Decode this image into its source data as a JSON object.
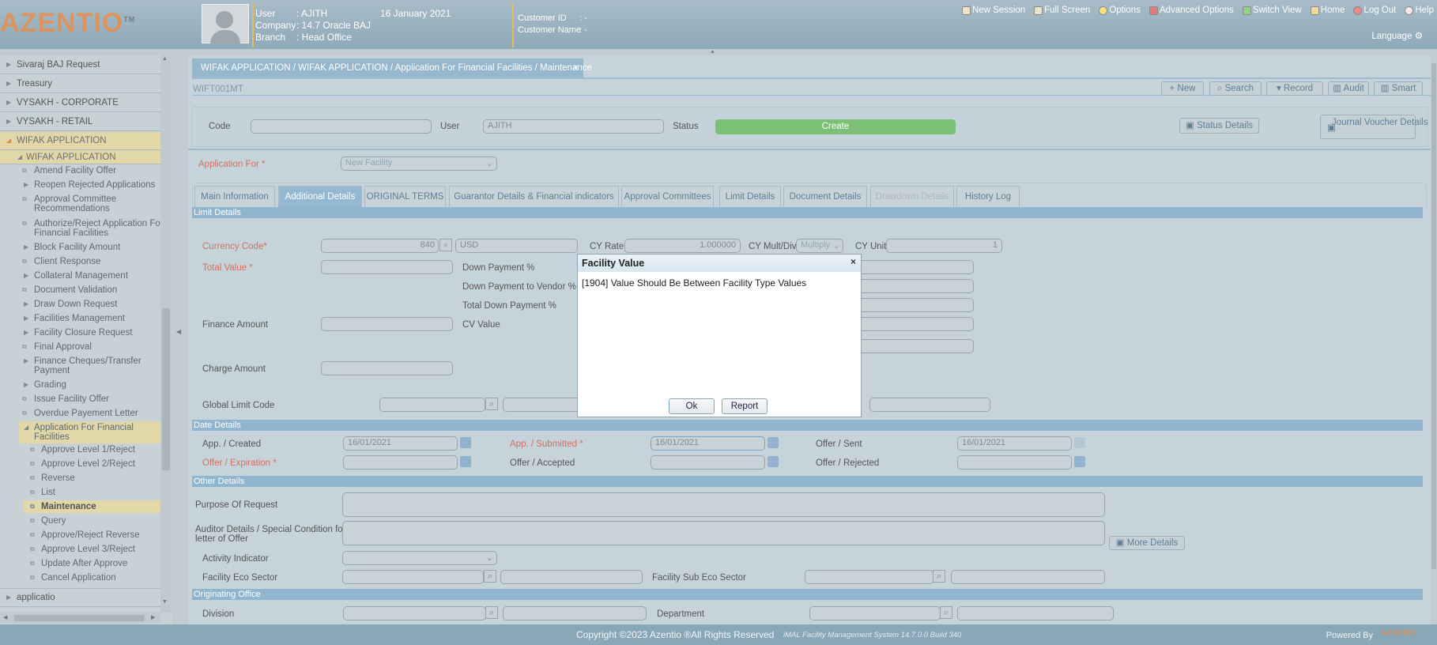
{
  "header": {
    "logo": "AZENTIO",
    "logo_tm": "TM",
    "user_label": "User",
    "user_value": ": AJITH",
    "company_label": "Company",
    "company_value": ": 14.7 Oracle BAJ",
    "branch_label": "Branch",
    "branch_value": ": Head Office",
    "date": "16 January 2021",
    "customer_id_label": "Customer ID",
    "customer_id_value": ":   -",
    "customer_name_label": "Customer Name",
    "customer_name_value": ": -",
    "links": [
      "New Session",
      "Full Screen",
      "Options",
      "Advanced Options",
      "Switch View",
      "Home",
      "Log Out",
      "Help"
    ],
    "language": "Language"
  },
  "sidebar": {
    "top_items": [
      "Sivaraj BAJ Request",
      "Treasury",
      "VYSAKH - CORPORATE",
      "VYSAKH - RETAIL",
      "WIFAK APPLICATION"
    ],
    "group": "WIFAK APPLICATION",
    "items": [
      "Amend Facility Offer",
      "Reopen Rejected Applications",
      "Approval Committee Recommendations",
      "Authorize/Reject Application For Financial Facilities",
      "Block Facility Amount",
      "Client Response",
      "Collateral Management",
      "Document Validation",
      "Draw Down Request",
      "Facilities Management",
      "Facility Closure Request",
      "Final Approval",
      "Finance Cheques/Transfer Payment",
      "Grading",
      "Issue Facility Offer",
      "Overdue Payement Letter",
      "Application For Financial Facilities"
    ],
    "subitems": [
      "Approve Level 1/Reject",
      "Approve Level 2/Reject",
      "Reverse",
      "List",
      "Maintenance",
      "Query",
      "Approve/Reject Reverse",
      "Approve Level 3/Reject",
      "Update After Approve",
      "Cancel Application"
    ],
    "bottom_item": "applicatio"
  },
  "breadcrumb": "WIFAK APPLICATION / WIFAK APPLICATION / Application For Financial Facilities / Maintenance",
  "screen_code": "WIFT001MT",
  "toolbar": [
    "New",
    "Search",
    "Record",
    "Audit",
    "Smart"
  ],
  "form": {
    "code_label": "Code",
    "user_label": "User",
    "user_value": "AJITH",
    "status_label": "Status",
    "status_value": "Create",
    "status_details": "Status Details",
    "journal_voucher": "Journal Voucher Details",
    "application_for_label": "Application For *",
    "application_for_value": "New Facility"
  },
  "tabs": [
    "Main Information",
    "Additional Details",
    "ORIGINAL TERMS",
    "Guarantor Details & Financial indicators",
    "Approval Committees",
    "Limit Details",
    "Document Details",
    "Drawdown Details",
    "History Log"
  ],
  "limit": {
    "section": "Limit Details",
    "currency_code_label": "Currency Code*",
    "currency_code_value": "840",
    "currency_name": "USD",
    "cy_rate_label": "CY Rate",
    "cy_rate_value": "1.000000",
    "cy_multdiv_label": "CY Mult/Div",
    "cy_multdiv_value": "Multiply",
    "cy_unit_label": "CY Unit",
    "cy_unit_value": "1",
    "total_value_label": "Total Value *",
    "down_payment_label": "Down Payment %",
    "down_payment_vendor_label": "Down Payment to Vendor %",
    "total_down_payment_label": "Total Down Payment %",
    "finance_amount_label": "Finance Amount",
    "cv_value_label": "CV Value",
    "charge_amount_label": "Charge Amount",
    "global_limit_label": "Global Limit Code"
  },
  "dates": {
    "section": "Date Details",
    "created_label": "App. / Created",
    "created_value": "16/01/2021",
    "submitted_label": "App. / Submitted *",
    "submitted_value": "16/01/2021",
    "sent_label": "Offer / Sent",
    "sent_value": "16/01/2021",
    "expiration_label": "Offer / Expiration *",
    "accepted_label": "Offer / Accepted",
    "rejected_label": "Offer / Rejected"
  },
  "other": {
    "section": "Other Details",
    "purpose_label": "Purpose Of Request",
    "auditor_label_1": "Auditor Details / Special Condition for",
    "auditor_label_2": "letter of Offer",
    "more_details": "More Details",
    "activity_label": "Activity Indicator",
    "eco_sector_label": "Facility Eco Sector",
    "sub_eco_sector_label": "Facility Sub Eco Sector"
  },
  "office": {
    "section": "Originating Office",
    "division_label": "Division",
    "department_label": "Department"
  },
  "dialog": {
    "title": "Facility Value",
    "close": "×",
    "message": "[1904] Value Should Be Between Facility Type Values",
    "ok": "Ok",
    "report": "Report"
  },
  "footer": {
    "copyright": "Copyright ©2023 Azentio ®All Rights Reserved",
    "system": "iMAL Facility Management System 14.7.0.0 Build 340",
    "powered": "Powered By",
    "powered_logo": "AZENTIO"
  }
}
